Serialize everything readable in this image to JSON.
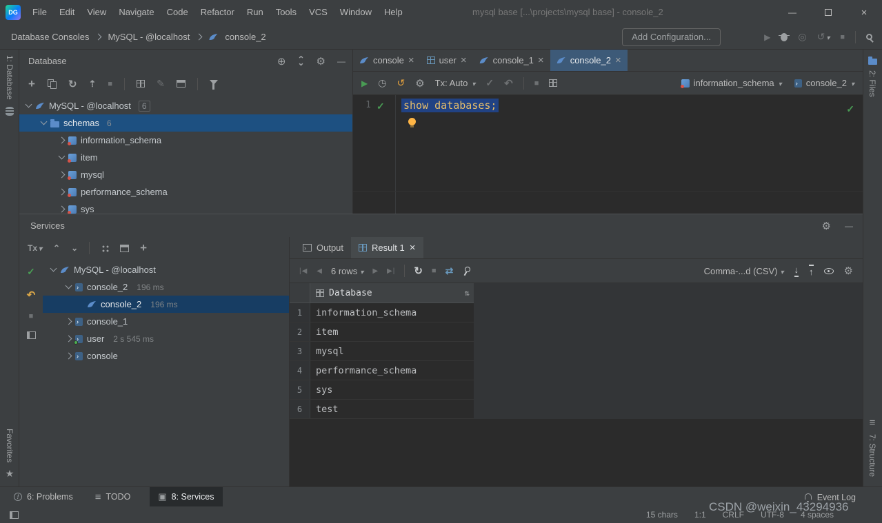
{
  "colors": {
    "accent_blue": "#3d7dc0",
    "editor_selection": "#214283",
    "tree_selection": "#1d5081",
    "run_green": "#499c54",
    "bulb_orange": "#ffb545",
    "code_text": "#e8bf6a"
  },
  "titlebar": {
    "logo": "DG",
    "menus": [
      "File",
      "Edit",
      "View",
      "Navigate",
      "Code",
      "Refactor",
      "Run",
      "Tools",
      "VCS",
      "Window",
      "Help"
    ],
    "title": "mysql base [...\\projects\\mysql base] - console_2"
  },
  "toolbar": {
    "breadcrumbs": [
      "Database Consoles",
      "MySQL - @localhost",
      "console_2"
    ],
    "add_configuration": "Add Configuration..."
  },
  "stripes": {
    "left_top": "1: Database",
    "left_bottom": "Favorites",
    "right_top": "2: Files",
    "right_bottom": "7: Structure"
  },
  "database_panel": {
    "title": "Database",
    "tree": [
      {
        "label": "MySQL - @localhost",
        "badge": "6"
      },
      {
        "label": "schemas",
        "badge": "6"
      },
      {
        "label": "information_schema"
      },
      {
        "label": "item"
      },
      {
        "label": "mysql"
      },
      {
        "label": "performance_schema"
      },
      {
        "label": "sys"
      }
    ]
  },
  "editor": {
    "tabs": [
      {
        "label": "console"
      },
      {
        "label": "user"
      },
      {
        "label": "console_1"
      },
      {
        "label": "console_2"
      }
    ],
    "tx_mode": "Tx: Auto",
    "schema_selector": "information_schema",
    "console_selector": "console_2",
    "line_number": "1",
    "code": "show databases;"
  },
  "services_panel": {
    "title": "Services",
    "tx_label": "Tx",
    "tree": [
      {
        "label": "MySQL - @localhost"
      },
      {
        "label": "console_2",
        "time": "196 ms"
      },
      {
        "label": "console_2",
        "time": "196 ms"
      },
      {
        "label": "console_1"
      },
      {
        "label": "user",
        "time": "2 s 545 ms"
      },
      {
        "label": "console"
      }
    ],
    "tabs": [
      {
        "label": "Output"
      },
      {
        "label": "Result 1"
      }
    ],
    "rows_count": "6 rows",
    "export_format": "Comma-...d (CSV)",
    "table": {
      "header": "Database",
      "rows": [
        {
          "num": "1",
          "value": "information_schema"
        },
        {
          "num": "2",
          "value": "item"
        },
        {
          "num": "3",
          "value": "mysql"
        },
        {
          "num": "4",
          "value": "performance_schema"
        },
        {
          "num": "5",
          "value": "sys"
        },
        {
          "num": "6",
          "value": "test"
        }
      ]
    }
  },
  "bottom_bar": {
    "problems": "6: Problems",
    "todo": "TODO",
    "services": "8: Services",
    "event_log": "Event Log"
  },
  "statusbar": {
    "chars": "15 chars",
    "position": "1:1",
    "line_ending": "CRLF",
    "encoding": "UTF-8",
    "indent": "4 spaces",
    "watermark": "CSDN @weixin_43294936"
  }
}
